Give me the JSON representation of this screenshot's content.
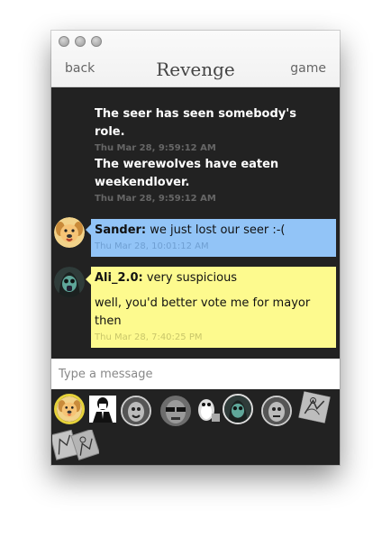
{
  "window": {
    "nav": {
      "back": "back",
      "title": "Revenge",
      "game": "game"
    }
  },
  "messages": [
    {
      "type": "system",
      "text": "The seer has seen somebody's role.",
      "time": "Thu Mar 28, 9:59:12 AM"
    },
    {
      "type": "system",
      "text": "The werewolves have eaten weekendlover.",
      "time": "Thu Mar 28, 9:59:12 AM"
    },
    {
      "type": "chat",
      "author": "Sander:",
      "lines": [
        "we just lost our seer :-("
      ],
      "time": "Thu Mar 28, 10:01:12 AM",
      "color": "#92c4f7"
    },
    {
      "type": "chat",
      "author": "Ali_2.0:",
      "lines": [
        "very suspicious",
        "well, you'd better vote me for mayor then"
      ],
      "time": "Thu Mar 28, 7:40:25 PM",
      "color": "#fdfa8e"
    }
  ],
  "input": {
    "placeholder": "Type a message"
  },
  "players": [
    {
      "icon": "dog-avatar-icon",
      "selected": true
    },
    {
      "icon": "man-in-suit-avatar-icon"
    },
    {
      "icon": "cartoon-face-avatar-icon"
    },
    {
      "icon": "face-with-sunglasses-avatar-icon"
    },
    {
      "icon": "penguin-robot-avatar-icon"
    },
    {
      "icon": "hooded-gasmask-avatar-icon"
    },
    {
      "icon": "cartoon-face-avatar-icon"
    },
    {
      "icon": "sketch-figure-avatar-icon"
    },
    {
      "icon": "sketch-figures-avatar-icon"
    }
  ],
  "colors": {
    "background": "#222222",
    "blue_bubble": "#92c4f7",
    "yellow_bubble": "#fdfa8e",
    "selected_ring": "#e6d23a"
  }
}
